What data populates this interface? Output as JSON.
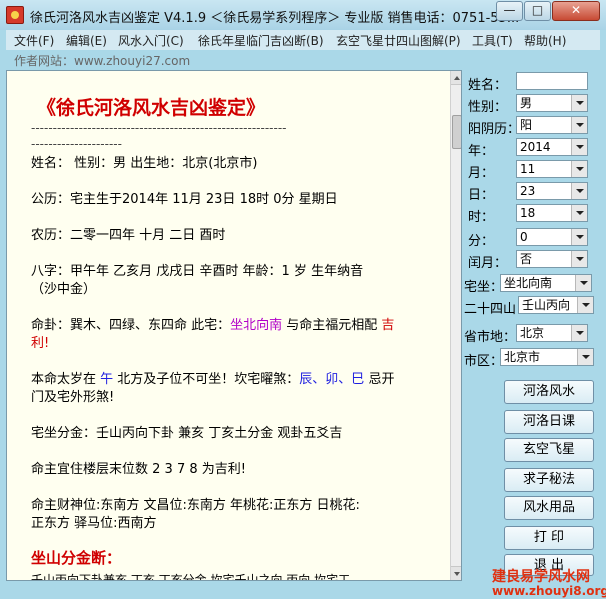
{
  "window": {
    "title": "徐氏河洛风水吉凶鉴定 V4.1.9 ＜徐氏易学系列程序＞ 专业版 销售电话：0751-55...",
    "min_label": "—",
    "max_label": "□",
    "close_label": "✕"
  },
  "menu": {
    "items": [
      "文件(F)",
      "编辑(E)",
      "风水入门(C)",
      "徐氏年星临门吉凶断(B)",
      "玄空飞星廿四山图解(P)",
      "工具(T)",
      "帮助(H)"
    ]
  },
  "website": "作者网站：www.zhouyi27.com",
  "report": {
    "title": "《徐氏河洛风水吉凶鉴定》",
    "dash_line": "-----------------------------------------------------------",
    "dash_line2": "---------------------",
    "name_line": "姓名：  性别：男    出生地：北京(北京市)",
    "gongli": "公历：宅主生于2014年 11月 23日 18时 0分 星期日",
    "nongli": "农历：二零一四年 十月 二日 酉时",
    "bazi_1": "八字：甲午年 乙亥月 戊戌日 辛酉时   年龄：1 岁   生年纳音",
    "bazi_2": "（沙中金）",
    "ming_a": "命卦：巽木、四绿、东四命   此宅：",
    "ming_zhai": "坐北向南",
    "ming_b": " 与命主福元相配 ",
    "ming_c": "吉",
    "ming_d": "利!",
    "taisui_a": "本命太岁在 ",
    "taisui_b": "午",
    "taisui_c": "  北方及子位不可坐！坎宅曜煞：",
    "taisui_d": "辰、卯、巳",
    "taisui_e": " 忌开",
    "taisui_f": "门及宅外形煞!",
    "fenjin": "宅坐分金：壬山丙向下卦    兼亥    丁亥土分金  观卦五爻吉",
    "louceng": "命主宜住楼层末位数 2 3 7 8 为吉利!",
    "caishen_1": "命主财神位:东南方   文昌位:东南方   年桃花:正东方   日桃花:",
    "caishen_2": "正东方   驿马位:西南方",
    "section": "坐山分金断：",
    "cut_line": "壬山丙向下卦兼亥  丁亥  丁亥分金  坎宅壬山之向  丙向  坎宅工"
  },
  "panel": {
    "labels": {
      "name": "姓名：",
      "gender": "性别：",
      "calendar": "阳阴历：",
      "year": "年：",
      "month": "月：",
      "day": "日：",
      "hour": "时：",
      "minute": "分：",
      "leap": "闰月：",
      "zuo": "宅坐：",
      "shan": "二十四山",
      "province": "省市地：",
      "city": "市区："
    },
    "values": {
      "name": "",
      "gender": "男",
      "calendar": "阳",
      "year": "2014",
      "month": "11",
      "day": "23",
      "hour": "18",
      "minute": "0",
      "leap": "否",
      "zuo": "坐北向南",
      "shan": "壬山丙向",
      "province": "北京",
      "city": "北京市"
    },
    "buttons": [
      "河洛风水",
      "河洛日课",
      "玄空飞星",
      "求子秘法",
      "风水用品",
      "打 印",
      "退 出"
    ]
  },
  "watermark": {
    "line1": "建良易学风水网",
    "line2": "www.zhouyi8.org"
  },
  "colors": {
    "window_bg": "#aad8e8",
    "text_area_bg": "#fffff0",
    "accent_red": "#d00000",
    "purple": "#b000c8",
    "blue": "#2020e0"
  }
}
